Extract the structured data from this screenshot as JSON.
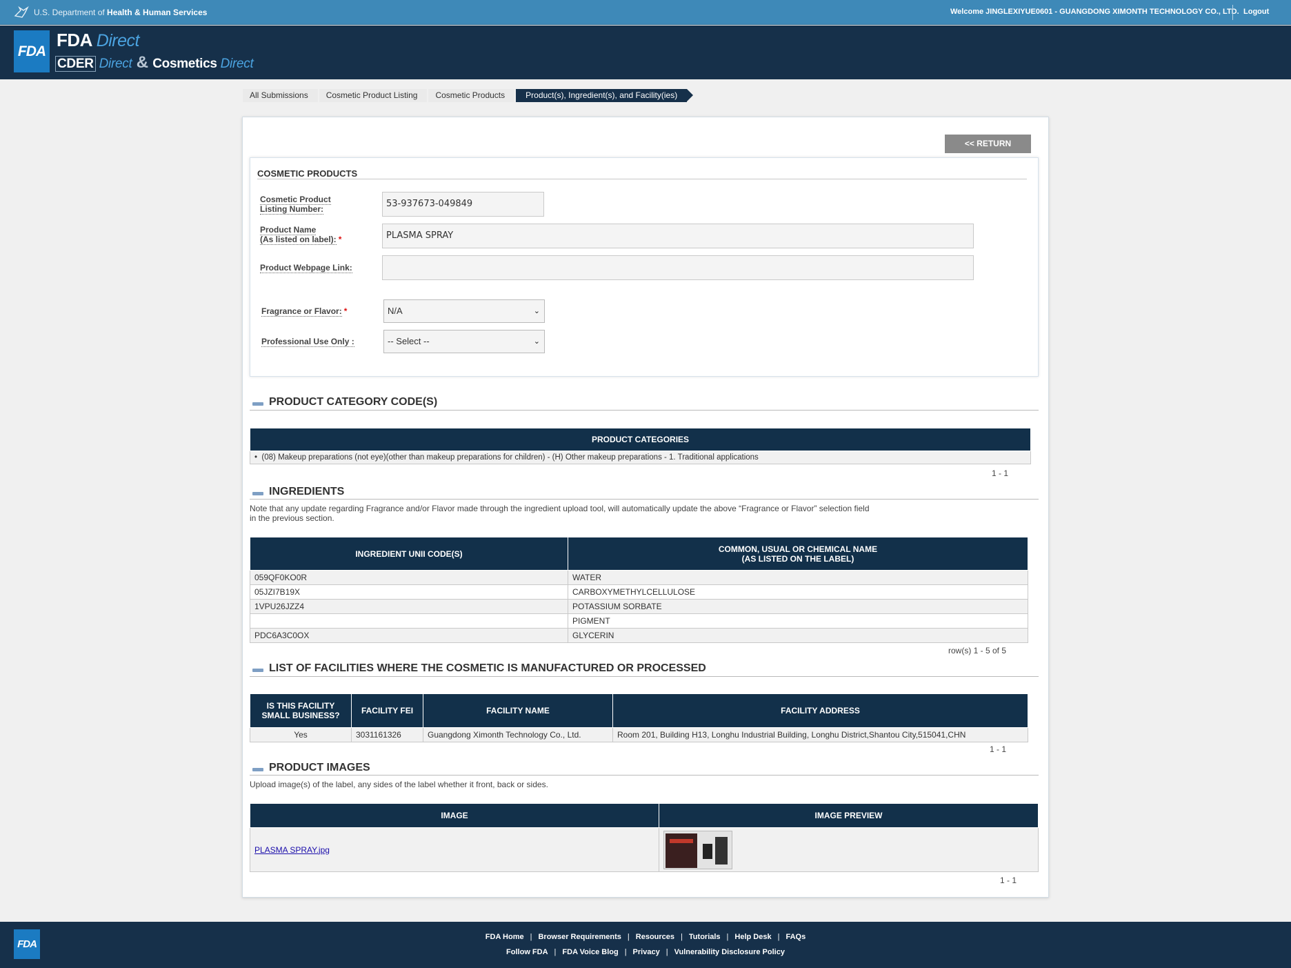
{
  "top_bar": {
    "dept_prefix": "U.S. Department of ",
    "dept_name": "Health & Human Services",
    "welcome": "Welcome JINGLEXIYUE0601 - GUANGDONG XIMONTH TECHNOLOGY CO., LTD.",
    "logout": "Logout"
  },
  "brand": {
    "logo_text": "FDA",
    "line1_main": "FDA ",
    "line1_accent": "Direct",
    "cder": "CDER",
    "cder_accent": " Direct",
    "amp": " & ",
    "cosmetics": "Cosmetics",
    "cosmetics_accent": " Direct"
  },
  "breadcrumb": [
    "All Submissions",
    "Cosmetic Product Listing",
    "Cosmetic Products",
    "Product(s), Ingredient(s), and Facility(ies)"
  ],
  "return_button": "<< RETURN",
  "cosmetic_products": {
    "title": "COSMETIC PRODUCTS",
    "listing_label_1": "Cosmetic Product",
    "listing_label_2": "Listing Number:",
    "listing_value": "53-937673-049849",
    "name_label_1": "Product Name",
    "name_label_2": "(As listed on label):",
    "name_value": "PLASMA SPRAY",
    "webpage_label": "Product Webpage Link:",
    "webpage_value": "",
    "fragrance_label": "Fragrance or Flavor:",
    "fragrance_value": "N/A",
    "professional_label": "Professional Use Only :",
    "professional_value": "-- Select --",
    "required_mark": "*"
  },
  "category_section": {
    "title": "PRODUCT CATEGORY CODE(S)",
    "table_header": "PRODUCT CATEGORIES",
    "rows": [
      "(08) Makeup preparations (not eye)(other than makeup preparations for children) - (H) Other makeup preparations - 1. Traditional applications"
    ],
    "pager": "1 - 1"
  },
  "ingredients_section": {
    "title": "INGREDIENTS",
    "note_line1": "Note that any update regarding Fragrance and/or Flavor made through the ingredient upload tool, will automatically update the above “Fragrance or Flavor” selection field",
    "note_line2": "in the previous section.",
    "col_code": "INGREDIENT UNII CODE(S)",
    "col_name_1": "COMMON, USUAL OR CHEMICAL NAME",
    "col_name_2": "(AS LISTED ON THE LABEL)",
    "rows": [
      {
        "code": "059QF0KO0R",
        "name": "WATER"
      },
      {
        "code": "05JZI7B19X",
        "name": "CARBOXYMETHYLCELLULOSE"
      },
      {
        "code": "1VPU26JZZ4",
        "name": "POTASSIUM SORBATE"
      },
      {
        "code": "",
        "name": "PIGMENT"
      },
      {
        "code": "PDC6A3C0OX",
        "name": "GLYCERIN"
      }
    ],
    "pager": "row(s) 1 - 5 of 5"
  },
  "facilities_section": {
    "title": "LIST OF FACILITIES WHERE THE COSMETIC IS MANUFACTURED OR PROCESSED",
    "col_small_1": "IS THIS FACILITY",
    "col_small_2": "SMALL BUSINESS?",
    "col_fei": "FACILITY FEI",
    "col_name": "FACILITY NAME",
    "col_address": "FACILITY ADDRESS",
    "rows": [
      {
        "small": "Yes",
        "fei": "3031161326",
        "name": "Guangdong Ximonth Technology Co., Ltd.",
        "address": "Room 201, Building H13, Longhu Industrial Building, Longhu District,Shantou City,515041,CHN"
      }
    ],
    "pager": "1 - 1"
  },
  "images_section": {
    "title": "PRODUCT IMAGES",
    "note": "Upload image(s) of the label, any sides of the label whether it front, back or sides.",
    "col_image": "IMAGE",
    "col_preview": "IMAGE PREVIEW",
    "rows": [
      {
        "file": "PLASMA SPRAY.jpg"
      }
    ],
    "pager": "1 - 1"
  },
  "footer": {
    "logo_text": "FDA",
    "row1": [
      "FDA Home",
      "Browser Requirements",
      "Resources",
      "Tutorials",
      "Help Desk",
      "FAQs"
    ],
    "row2": [
      "Follow FDA",
      "FDA Voice Blog",
      "Privacy",
      "Vulnerability Disclosure Policy"
    ],
    "separator": "|"
  }
}
